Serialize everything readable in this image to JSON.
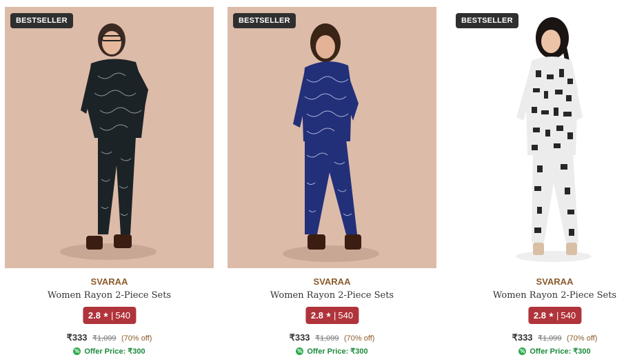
{
  "products": [
    {
      "badge": "BESTSELLER",
      "brand": "SVARAA",
      "title": "Women Rayon 2-Piece Sets",
      "rating": "2.8",
      "rating_sep": "|",
      "reviews": "540",
      "price": "₹333",
      "mrp": "₹1,099",
      "discount": "(70% off)",
      "offer_label": "Offer Price: ₹300",
      "image_theme": "black-print"
    },
    {
      "badge": "BESTSELLER",
      "brand": "SVARAA",
      "title": "Women Rayon 2-Piece Sets",
      "rating": "2.8",
      "rating_sep": "|",
      "reviews": "540",
      "price": "₹333",
      "mrp": "₹1,099",
      "discount": "(70% off)",
      "offer_label": "Offer Price: ₹300",
      "image_theme": "blue-print"
    },
    {
      "badge": "BESTSELLER",
      "brand": "SVARAA",
      "title": "Women Rayon 2-Piece Sets",
      "rating": "2.8",
      "rating_sep": "|",
      "reviews": "540",
      "price": "₹333",
      "mrp": "₹1,099",
      "discount": "(70% off)",
      "offer_label": "Offer Price: ₹300",
      "image_theme": "white-print"
    }
  ],
  "colors": {
    "badge_bg": "#2f2f2f",
    "brand": "#8b5a2b",
    "rating_bg": "#b0343b",
    "offer_green": "#1b8a3a",
    "photo_bg": "#d9b8a6"
  },
  "icons": {
    "star": "star-icon",
    "offer": "percent-badge-icon"
  }
}
